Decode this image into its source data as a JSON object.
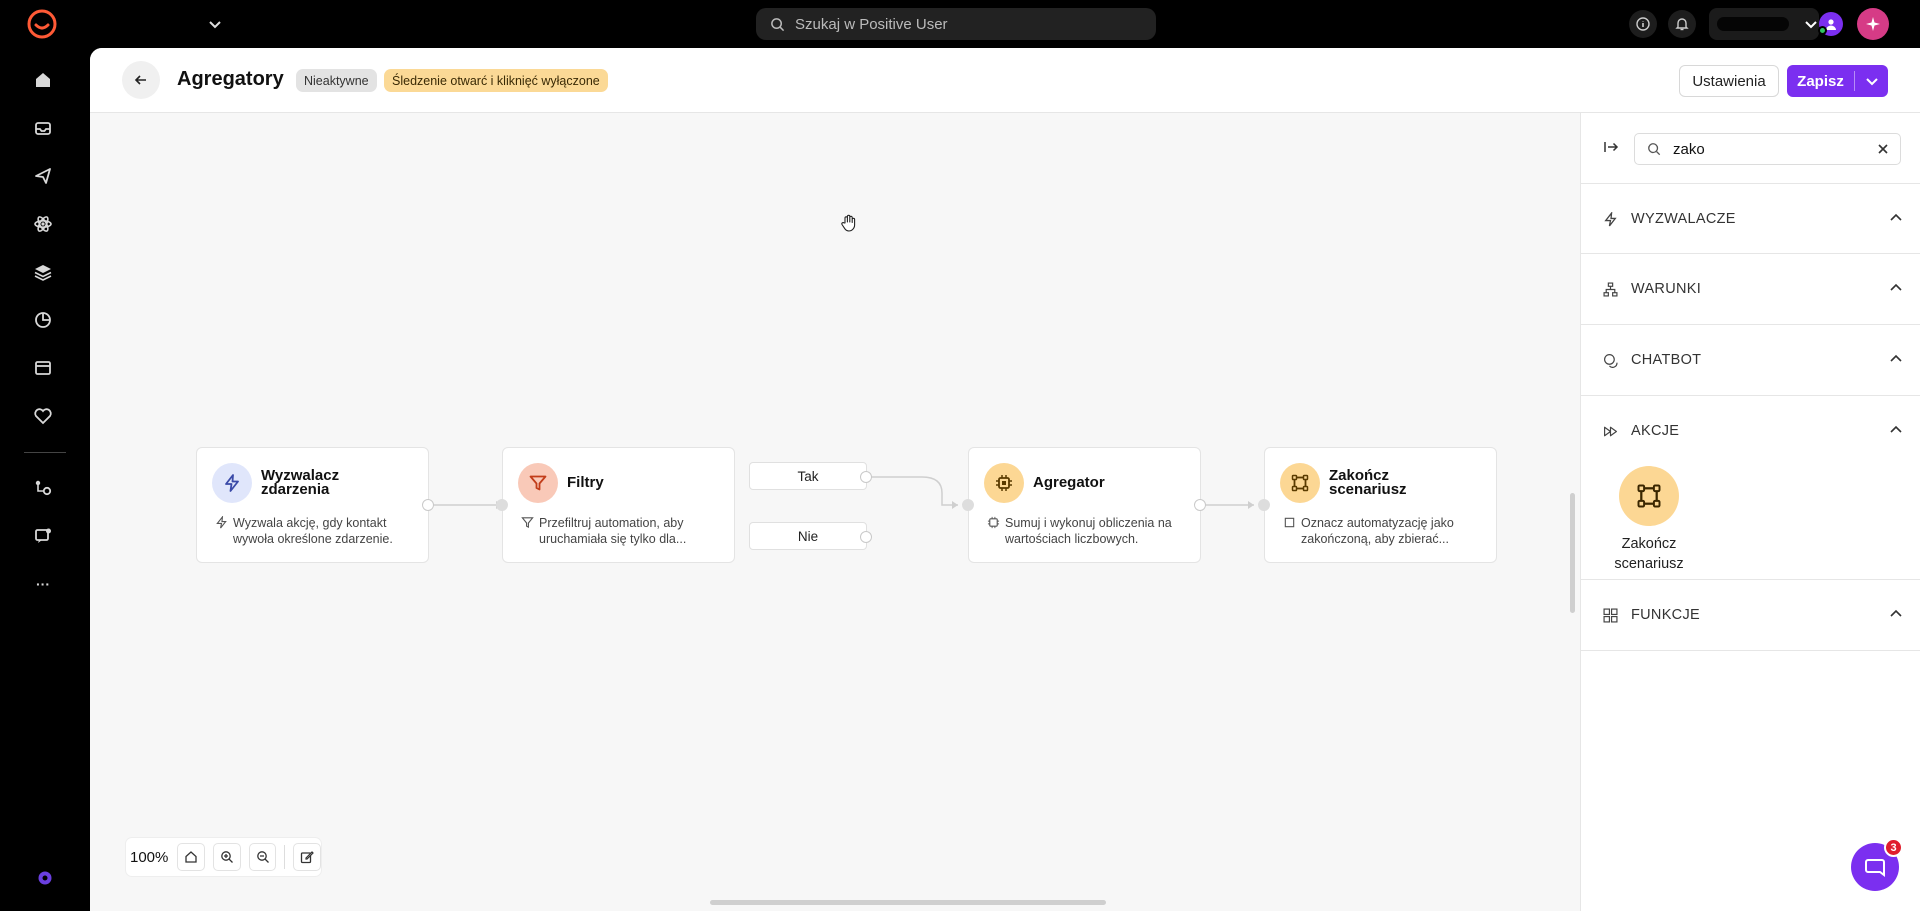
{
  "topbar": {
    "search_placeholder": "Szukaj w Positive User",
    "icons": [
      "logo-icon",
      "chevron-down-icon",
      "search-icon",
      "info-icon",
      "bell-icon",
      "avatar",
      "sparkle-icon"
    ]
  },
  "sidebar": {
    "items": [
      "home-icon",
      "inbox-icon",
      "send-icon",
      "atom-icon",
      "layers-icon",
      "pie-chart-icon",
      "window-icon",
      "heart-tag-icon",
      "flow-icon",
      "message-settings-icon",
      "more-icon"
    ],
    "more_label": "···"
  },
  "header": {
    "title": "Agregatory",
    "status_badge": "Nieaktywne",
    "tracking_badge": "Śledzenie otwarć i kliknięć wyłączone",
    "settings_label": "Ustawienia",
    "save_label": "Zapisz"
  },
  "nodes": [
    {
      "title_line1": "Wyzwalacz",
      "title_line2": "zdarzenia",
      "description": "Wyzwala akcję, gdy kontakt wywoła określone zdarzenie.",
      "icon": "bolt-icon",
      "icon_bg": "#e0e6fb",
      "icon_color": "#3a4aa8"
    },
    {
      "title_line1": "Filtry",
      "title_line2": "",
      "description": "Przefiltruj automation, aby uruchamiała się tylko dla...",
      "icon": "funnel-icon",
      "icon_bg": "#f9c9b8",
      "icon_color": "#c23d1a"
    },
    {
      "title_line1": "Agregator",
      "title_line2": "",
      "description": "Sumuj i wykonuj obliczenia na wartościach liczbowych.",
      "icon": "cpu-icon",
      "icon_bg": "#fcd794",
      "icon_color": "#5a3b00"
    },
    {
      "title_line1": "Zakończ",
      "title_line2": "scenariusz",
      "description": "Oznacz automatyzację jako zakończoną, aby zbierać...",
      "icon": "frame-icon",
      "icon_bg": "#fcd794",
      "icon_color": "#5a3b00"
    }
  ],
  "branches": {
    "yes": "Tak",
    "no": "Nie"
  },
  "zoom": {
    "value": "100%"
  },
  "panel": {
    "search_value": "zako",
    "sections": {
      "triggers": "WYZWALACZE",
      "conditions": "WARUNKI",
      "chatbot": "CHATBOT",
      "actions": "AKCJE",
      "functions": "FUNKCJE"
    },
    "action_item": {
      "line1": "Zakończ",
      "line2": "scenariusz"
    }
  },
  "chat": {
    "badge_count": "3"
  },
  "colors": {
    "accent": "#7b2ff0",
    "warning_badge": "#fbd996",
    "node_amber": "#fcd794"
  }
}
